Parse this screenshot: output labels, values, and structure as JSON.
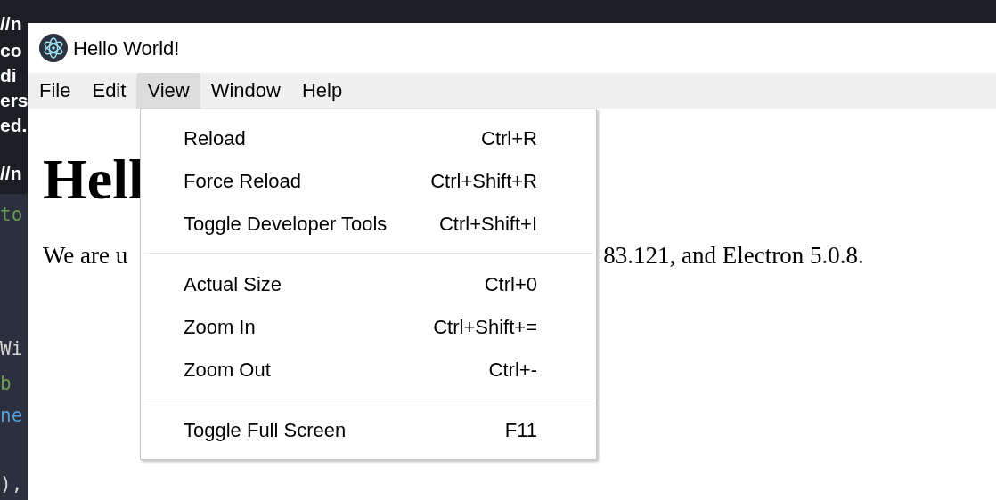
{
  "background_terminal": {
    "lines": [
      {
        "text": "//n",
        "kind": "plain"
      },
      {
        "text": "co",
        "kind": "plain"
      },
      {
        "text": "di",
        "kind": "plain"
      },
      {
        "text": "ers",
        "kind": "plain"
      },
      {
        "text": "ed.",
        "kind": "plain"
      },
      {
        "text": "//n",
        "kind": "plain"
      },
      {
        "text": "to",
        "kind": "code",
        "color": "#6a9955"
      },
      {
        "text": "Wi",
        "kind": "code",
        "color": "#d4d4d4"
      },
      {
        "text": "b",
        "kind": "code",
        "color": "#6a9955"
      },
      {
        "text": "ne",
        "kind": "code",
        "color": "#569cd6"
      },
      {
        "text": "),",
        "kind": "code",
        "color": "#d4d4d4"
      }
    ]
  },
  "window": {
    "title": "Hello World!"
  },
  "menu_bar": [
    {
      "label": "File",
      "selected": false
    },
    {
      "label": "Edit",
      "selected": false
    },
    {
      "label": "View",
      "selected": true
    },
    {
      "label": "Window",
      "selected": false
    },
    {
      "label": "Help",
      "selected": false
    }
  ],
  "content": {
    "heading": "Hell",
    "paragraph_start": "We are u",
    "paragraph_end": "83.121, and Electron 5.0.8."
  },
  "dropdown": {
    "groups": [
      [
        {
          "label": "Reload",
          "shortcut": "Ctrl+R"
        },
        {
          "label": "Force Reload",
          "shortcut": "Ctrl+Shift+R"
        },
        {
          "label": "Toggle Developer Tools",
          "shortcut": "Ctrl+Shift+I"
        }
      ],
      [
        {
          "label": "Actual Size",
          "shortcut": "Ctrl+0"
        },
        {
          "label": "Zoom In",
          "shortcut": "Ctrl+Shift+="
        },
        {
          "label": "Zoom Out",
          "shortcut": "Ctrl+-"
        }
      ],
      [
        {
          "label": "Toggle Full Screen",
          "shortcut": "F11"
        }
      ]
    ]
  }
}
